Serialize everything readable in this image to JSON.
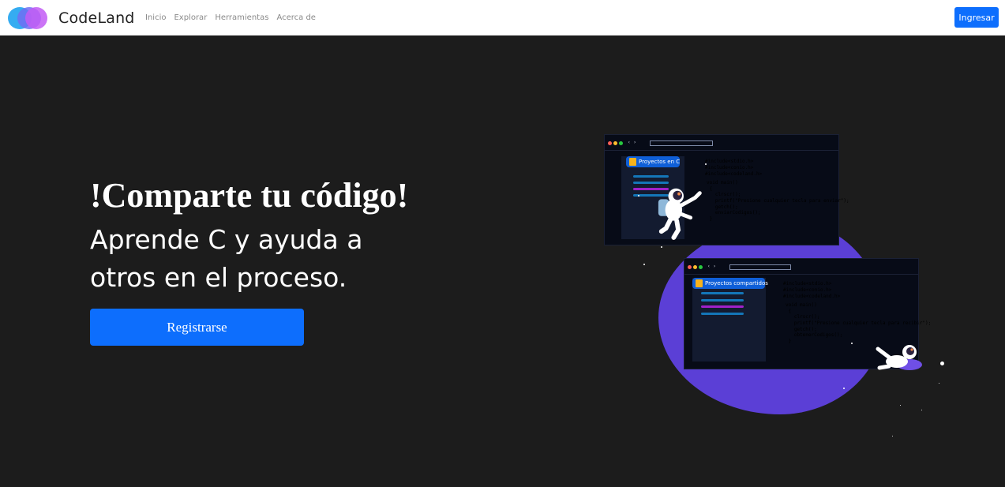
{
  "nav": {
    "brand": "CodeLand",
    "links": [
      "Inicio",
      "Explorar",
      "Herramientas",
      "Acerca de"
    ],
    "login_label": "Ingresar"
  },
  "hero": {
    "title": "!Comparte tu código!",
    "subtitle": "Aprende C y ayuda a otros en el proceso.",
    "register_label": "Registrarse"
  },
  "illustration": {
    "window1": {
      "folder_label": "Proyectos en C",
      "code_includes": "#include<stdio.h>\n#include<conio.h>\n#include<codeland.h>",
      "code_main": "void main()\n {",
      "code_body": "   clrscr();\n   printf(\"Presione cualquier tecla para enviar\");\n   getch();\n   enviarCodigos();\n }"
    },
    "window2": {
      "folder_label": "Proyectos compartidos",
      "code_includes": "#include<stdio.h>\n#include<conio.h>\n#include<codeland.h>",
      "code_main": "void main()\n {",
      "code_body": "   clrscr();\n   printf(\"Presione cualquier tecla para recibir\");\n   getch();\n   obtenerCodigos();\n }"
    }
  },
  "colors": {
    "primary": "#0d6efd",
    "background": "#1c1c1c",
    "blob": "#5b3fd6",
    "code_green": "#4fe28b",
    "code_yellow": "#f4e17a"
  }
}
